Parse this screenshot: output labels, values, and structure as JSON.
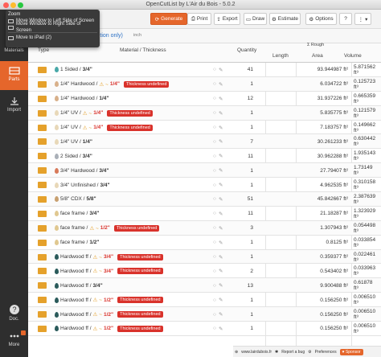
{
  "window": {
    "title": "OpenCutList by L'Air du Bois - 5.0.2"
  },
  "menu": {
    "items": [
      "Zoom",
      "Move Window to Left Side of Screen",
      "Move Window to Right Side of Screen",
      "Move to iPad (2)"
    ]
  },
  "sidebar": {
    "items": [
      {
        "label": "Materials"
      },
      {
        "label": "Parts"
      },
      {
        "label": "Import"
      },
      {
        "label": "Doc."
      },
      {
        "label": "More"
      }
    ]
  },
  "toolbar": {
    "generate": "Generate",
    "print": "Print",
    "export": "Export",
    "draw": "Draw",
    "estimate": "Estimate",
    "options": "Options",
    "help": "?",
    "more": "⋮"
  },
  "tabs": {
    "selection": "ection only)",
    "unit": "inch"
  },
  "table": {
    "headers": {
      "type": "Type",
      "material": "Material / Thickness",
      "quantity": "Quantity",
      "group": "Σ Rough",
      "length": "Length",
      "area": "Area",
      "volume": "Volume"
    },
    "rows": [
      {
        "mat": "1 Sided / ",
        "thick": "3/4\"",
        "qty": "41",
        "area": "93.944987 ft²",
        "vol": "5.871562 ft³",
        "color": "#48a8a8"
      },
      {
        "mat": "1/4\" Hardwood / ",
        "thick": "1/4\"",
        "warn": true,
        "badge": "Thickness undefined",
        "qty": "1",
        "area": "6.034722 ft²",
        "vol": "0.125723 ft³",
        "color": "#d8b08a"
      },
      {
        "mat": "1/4\" Hardwood / ",
        "thick": "1/4\"",
        "qty": "12",
        "area": "31.937226 ft²",
        "vol": "0.665359 ft³",
        "color": "#d8b08a"
      },
      {
        "mat": "1/4\" UV / ",
        "thick": "1/4\"",
        "warn": true,
        "badge": "Thickness undefined",
        "qty": "1",
        "area": "5.835775 ft²",
        "vol": "0.121579 ft³",
        "color": "#e8d8b8"
      },
      {
        "mat": "1/4\" UV / ",
        "thick": "1/4\"",
        "warn": true,
        "badge": "Thickness undefined",
        "qty": "1",
        "area": "7.183757 ft²",
        "vol": "0.149662 ft³",
        "color": "#e8d8b8"
      },
      {
        "mat": "1/4\" UV / ",
        "thick": "1/4\"",
        "qty": "7",
        "area": "30.261233 ft²",
        "vol": "0.630442 ft³",
        "color": "#e8d8b8"
      },
      {
        "mat": "2 Sided / ",
        "thick": "3/4\"",
        "qty": "11",
        "area": "30.962288 ft²",
        "vol": "1.935143 ft³",
        "color": "#aab0b8"
      },
      {
        "mat": "3/4\" Hardwood / ",
        "thick": "3/4\"",
        "qty": "1",
        "area": "27.79407 ft²",
        "vol": "1.73149 ft³",
        "color": "#d87a5a"
      },
      {
        "mat": "3/4\" Unfinished / ",
        "thick": "3/4\"",
        "qty": "1",
        "area": "4.962535 ft²",
        "vol": "0.310158 ft³",
        "color": "#e8d8b8"
      },
      {
        "mat": "5/8\" CDX / ",
        "thick": "5/8\"",
        "qty": "51",
        "area": "45.842667 ft²",
        "vol": "2.387639 ft³",
        "color": "#c8a070"
      },
      {
        "mat": "face frame / ",
        "thick": "3/4\"",
        "qty": "11",
        "area": "21.18287 ft²",
        "vol": "1.323929 ft³",
        "color": "#e0c890"
      },
      {
        "mat": "face frame / ",
        "thick": "1/2\"",
        "warn": true,
        "badge": "Thickness undefined",
        "qty": "3",
        "area": "1.307943 ft²",
        "vol": "0.054498 ft³",
        "color": "#e0c890"
      },
      {
        "mat": "face frame / ",
        "thick": "1/2\"",
        "qty": "1",
        "area": "0.8125 ft²",
        "vol": "0.033854 ft³",
        "color": "#e0c890"
      },
      {
        "mat": "Hardwood ff / ",
        "thick": "3/4\"",
        "warn": true,
        "badge": "Thickness undefined",
        "qty": "1",
        "area": "0.359377 ft²",
        "vol": "0.022461 ft³",
        "color": "#2a5a5a"
      },
      {
        "mat": "Hardwood ff / ",
        "thick": "3/4\"",
        "warn": true,
        "badge": "Thickness undefined",
        "qty": "2",
        "area": "0.543402 ft²",
        "vol": "0.033963 ft³",
        "color": "#2a5a5a"
      },
      {
        "mat": "Hardwood ff / ",
        "thick": "3/4\"",
        "qty": "13",
        "area": "9.900488 ft²",
        "vol": "0.61878 ft³",
        "color": "#2a5a5a"
      },
      {
        "mat": "Hardwood ff / ",
        "thick": "1/2\"",
        "warn": true,
        "badge": "Thickness undefined",
        "qty": "1",
        "area": "0.156250 ft²",
        "vol": "0.006510 ft³",
        "color": "#2a5a5a"
      },
      {
        "mat": "Hardwood ff / ",
        "thick": "1/2\"",
        "warn": true,
        "badge": "Thickness undefined",
        "qty": "1",
        "area": "0.156250 ft²",
        "vol": "0.006510 ft³",
        "color": "#2a5a5a"
      },
      {
        "mat": "Hardwood ff / ",
        "thick": "1/2\"",
        "warn": true,
        "badge": "Thickness undefined",
        "qty": "1",
        "area": "0.156250 ft²",
        "vol": "0.006510 ft³",
        "color": "#2a5a5a"
      }
    ]
  },
  "status": {
    "site": "www.lairdubois.fr",
    "bug": "Report a bug",
    "prefs": "Preferences",
    "sponsor": "Sponsor"
  },
  "colors": {
    "accent": "#e5662b",
    "sidebar": "#2e2e2e",
    "error": "#d9322b",
    "warning": "#e5a12b"
  }
}
